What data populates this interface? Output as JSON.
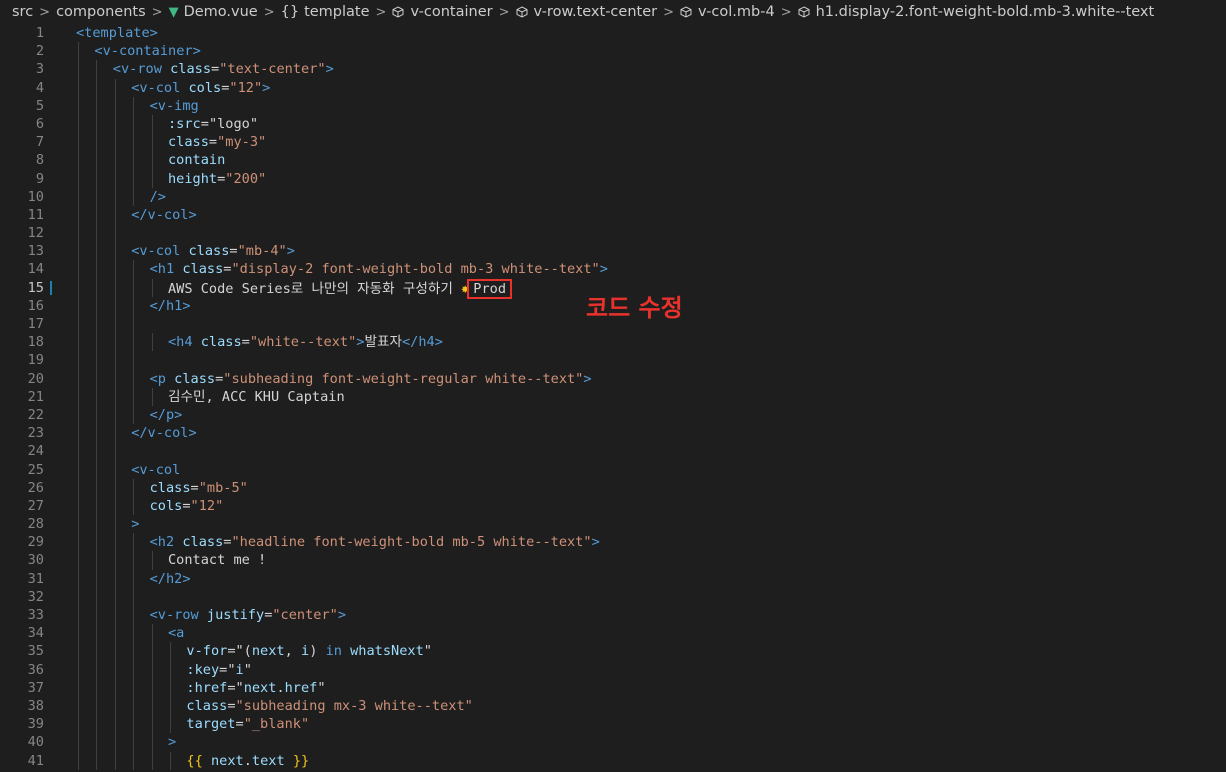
{
  "breadcrumb": {
    "items": [
      "src",
      "components",
      "Demo.vue",
      "template",
      "v-container",
      "v-row.text-center",
      "v-col.mb-4",
      "h1.display-2.font-weight-bold.mb-3.white--text"
    ],
    "separator": ">",
    "icons": [
      "",
      "",
      "vue-icon",
      "braces-icon",
      "cube-icon",
      "cube-icon",
      "cube-icon",
      "cube-icon"
    ]
  },
  "editor": {
    "active_line": 15,
    "modified_line": 15,
    "lines": [
      {
        "n": "1",
        "indent": 0,
        "parts": [
          [
            "tag",
            "<template>"
          ]
        ]
      },
      {
        "n": "2",
        "indent": 1,
        "parts": [
          [
            "tag",
            "<v-container>"
          ]
        ]
      },
      {
        "n": "3",
        "indent": 2,
        "parts": [
          [
            "tag",
            "<v-row"
          ],
          [
            "txt",
            " "
          ],
          [
            "attr",
            "class"
          ],
          [
            "txt",
            "="
          ],
          [
            "str",
            "\"text-center\""
          ],
          [
            "tag",
            ">"
          ]
        ]
      },
      {
        "n": "4",
        "indent": 3,
        "parts": [
          [
            "tag",
            "<v-col"
          ],
          [
            "txt",
            " "
          ],
          [
            "attr",
            "cols"
          ],
          [
            "txt",
            "="
          ],
          [
            "str",
            "\"12\""
          ],
          [
            "tag",
            ">"
          ]
        ]
      },
      {
        "n": "5",
        "indent": 4,
        "parts": [
          [
            "tag",
            "<v-img"
          ]
        ]
      },
      {
        "n": "6",
        "indent": 5,
        "parts": [
          [
            "attr",
            ":src"
          ],
          [
            "txt",
            "="
          ],
          [
            "txt",
            "\"logo\""
          ]
        ]
      },
      {
        "n": "7",
        "indent": 5,
        "parts": [
          [
            "attr",
            "class"
          ],
          [
            "txt",
            "="
          ],
          [
            "str",
            "\"my-3\""
          ]
        ]
      },
      {
        "n": "8",
        "indent": 5,
        "parts": [
          [
            "attr",
            "contain"
          ]
        ]
      },
      {
        "n": "9",
        "indent": 5,
        "parts": [
          [
            "attr",
            "height"
          ],
          [
            "txt",
            "="
          ],
          [
            "str",
            "\"200\""
          ]
        ]
      },
      {
        "n": "10",
        "indent": 4,
        "parts": [
          [
            "tag",
            "/>"
          ]
        ]
      },
      {
        "n": "11",
        "indent": 3,
        "parts": [
          [
            "tag",
            "</v-col>"
          ]
        ]
      },
      {
        "n": "12",
        "indent": 3,
        "parts": []
      },
      {
        "n": "13",
        "indent": 3,
        "parts": [
          [
            "tag",
            "<v-col"
          ],
          [
            "txt",
            " "
          ],
          [
            "attr",
            "class"
          ],
          [
            "txt",
            "="
          ],
          [
            "str",
            "\"mb-4\""
          ],
          [
            "tag",
            ">"
          ]
        ]
      },
      {
        "n": "14",
        "indent": 4,
        "parts": [
          [
            "tag",
            "<h1"
          ],
          [
            "txt",
            " "
          ],
          [
            "attr",
            "class"
          ],
          [
            "txt",
            "="
          ],
          [
            "str",
            "\"display-2 font-weight-bold mb-3 white--text\""
          ],
          [
            "tag",
            ">"
          ]
        ]
      },
      {
        "n": "15",
        "indent": 5,
        "parts": [
          [
            "txt",
            "AWS Code Series로 나만의 자동화 구성하기 "
          ],
          [
            "spark",
            "✸"
          ],
          [
            "prod",
            "Prod"
          ]
        ]
      },
      {
        "n": "16",
        "indent": 4,
        "parts": [
          [
            "tag",
            "</h1>"
          ]
        ]
      },
      {
        "n": "17",
        "indent": 4,
        "parts": []
      },
      {
        "n": "18",
        "indent": 5,
        "parts": [
          [
            "tag",
            "<h4"
          ],
          [
            "txt",
            " "
          ],
          [
            "attr",
            "class"
          ],
          [
            "txt",
            "="
          ],
          [
            "str",
            "\"white--text\""
          ],
          [
            "tag",
            ">"
          ],
          [
            "txt",
            "발표자"
          ],
          [
            "tag",
            "</h4>"
          ]
        ]
      },
      {
        "n": "19",
        "indent": 4,
        "parts": []
      },
      {
        "n": "20",
        "indent": 4,
        "parts": [
          [
            "tag",
            "<p"
          ],
          [
            "txt",
            " "
          ],
          [
            "attr",
            "class"
          ],
          [
            "txt",
            "="
          ],
          [
            "str",
            "\"subheading font-weight-regular white--text\""
          ],
          [
            "tag",
            ">"
          ]
        ]
      },
      {
        "n": "21",
        "indent": 5,
        "parts": [
          [
            "txt",
            "김수민, ACC KHU Captain"
          ]
        ]
      },
      {
        "n": "22",
        "indent": 4,
        "parts": [
          [
            "tag",
            "</p>"
          ]
        ]
      },
      {
        "n": "23",
        "indent": 3,
        "parts": [
          [
            "tag",
            "</v-col>"
          ]
        ]
      },
      {
        "n": "24",
        "indent": 3,
        "parts": []
      },
      {
        "n": "25",
        "indent": 3,
        "parts": [
          [
            "tag",
            "<v-col"
          ]
        ]
      },
      {
        "n": "26",
        "indent": 4,
        "parts": [
          [
            "attr",
            "class"
          ],
          [
            "txt",
            "="
          ],
          [
            "str",
            "\"mb-5\""
          ]
        ]
      },
      {
        "n": "27",
        "indent": 4,
        "parts": [
          [
            "attr",
            "cols"
          ],
          [
            "txt",
            "="
          ],
          [
            "str",
            "\"12\""
          ]
        ]
      },
      {
        "n": "28",
        "indent": 3,
        "parts": [
          [
            "tag",
            ">"
          ]
        ]
      },
      {
        "n": "29",
        "indent": 4,
        "parts": [
          [
            "tag",
            "<h2"
          ],
          [
            "txt",
            " "
          ],
          [
            "attr",
            "class"
          ],
          [
            "txt",
            "="
          ],
          [
            "str",
            "\"headline font-weight-bold mb-5 white--text\""
          ],
          [
            "tag",
            ">"
          ]
        ]
      },
      {
        "n": "30",
        "indent": 5,
        "parts": [
          [
            "txt",
            "Contact me !"
          ]
        ]
      },
      {
        "n": "31",
        "indent": 4,
        "parts": [
          [
            "tag",
            "</h2>"
          ]
        ]
      },
      {
        "n": "32",
        "indent": 4,
        "parts": []
      },
      {
        "n": "33",
        "indent": 4,
        "parts": [
          [
            "tag",
            "<v-row"
          ],
          [
            "txt",
            " "
          ],
          [
            "attr",
            "justify"
          ],
          [
            "txt",
            "="
          ],
          [
            "str",
            "\"center\""
          ],
          [
            "tag",
            ">"
          ]
        ]
      },
      {
        "n": "34",
        "indent": 5,
        "parts": [
          [
            "tag",
            "<a"
          ]
        ]
      },
      {
        "n": "35",
        "indent": 6,
        "parts": [
          [
            "attr",
            "v-for"
          ],
          [
            "txt",
            "=\"("
          ],
          [
            "attr",
            "next"
          ],
          [
            "txt",
            ", "
          ],
          [
            "attr",
            "i"
          ],
          [
            "txt",
            ") "
          ],
          [
            "kw",
            "in"
          ],
          [
            "txt",
            " "
          ],
          [
            "attr",
            "whatsNext"
          ],
          [
            "txt",
            "\""
          ]
        ]
      },
      {
        "n": "36",
        "indent": 6,
        "parts": [
          [
            "attr",
            ":key"
          ],
          [
            "txt",
            "=\""
          ],
          [
            "attr",
            "i"
          ],
          [
            "txt",
            "\""
          ]
        ]
      },
      {
        "n": "37",
        "indent": 6,
        "parts": [
          [
            "attr",
            ":href"
          ],
          [
            "txt",
            "=\""
          ],
          [
            "attr",
            "next"
          ],
          [
            "txt",
            "."
          ],
          [
            "attr",
            "href"
          ],
          [
            "txt",
            "\""
          ]
        ]
      },
      {
        "n": "38",
        "indent": 6,
        "parts": [
          [
            "attr",
            "class"
          ],
          [
            "txt",
            "="
          ],
          [
            "str",
            "\"subheading mx-3 white--text\""
          ]
        ]
      },
      {
        "n": "39",
        "indent": 6,
        "parts": [
          [
            "attr",
            "target"
          ],
          [
            "txt",
            "="
          ],
          [
            "str",
            "\"_blank\""
          ]
        ]
      },
      {
        "n": "40",
        "indent": 5,
        "parts": [
          [
            "tag",
            ">"
          ]
        ]
      },
      {
        "n": "41",
        "indent": 6,
        "parts": [
          [
            "spark",
            "{{"
          ],
          [
            "txt",
            " "
          ],
          [
            "attr",
            "next"
          ],
          [
            "txt",
            "."
          ],
          [
            "attr",
            "text"
          ],
          [
            "txt",
            " "
          ],
          [
            "spark",
            "}}"
          ]
        ]
      }
    ]
  },
  "annotation": {
    "text": "코드 수정",
    "color": "#e8322b"
  },
  "colors": {
    "background": "#1e1e1e",
    "tag": "#569cd6",
    "attr": "#9cdcfe",
    "string": "#ce9178",
    "highlight": "#e8322b"
  }
}
